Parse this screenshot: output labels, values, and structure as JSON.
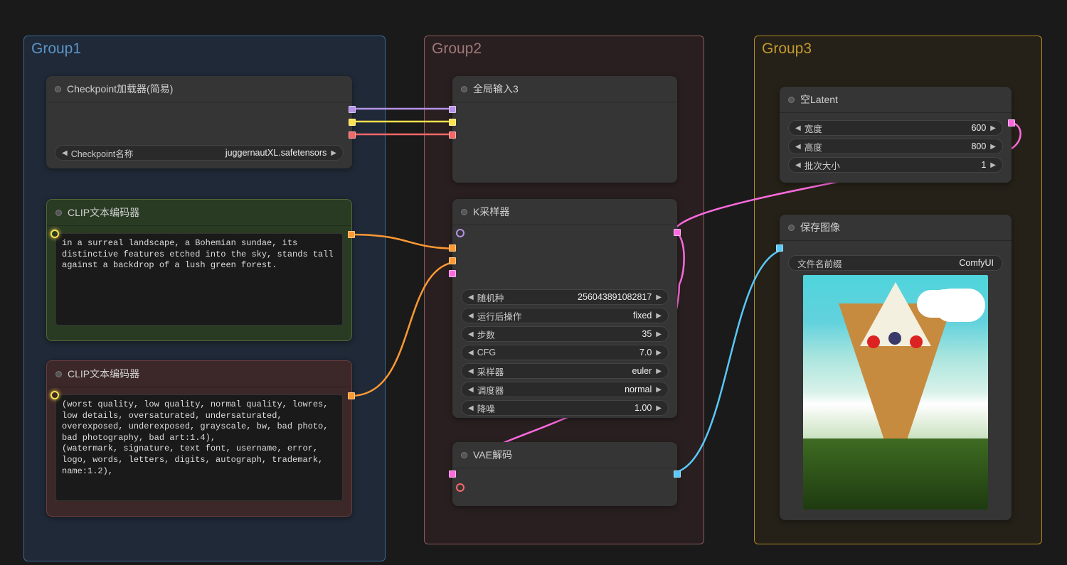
{
  "groups": {
    "g1": {
      "title": "Group1"
    },
    "g2": {
      "title": "Group2"
    },
    "g3": {
      "title": "Group3"
    }
  },
  "nodes": {
    "checkpoint": {
      "title": "Checkpoint加载器(简易)",
      "widget_label": "Checkpoint名称",
      "widget_value": "juggernautXL.safetensors"
    },
    "clip_pos": {
      "title": "CLIP文本编码器",
      "text": "in a surreal landscape, a Bohemian sundae, its distinctive features etched into the sky, stands tall against a backdrop of a lush green forest."
    },
    "clip_neg": {
      "title": "CLIP文本编码器",
      "text": "(worst quality, low quality, normal quality, lowres, low details, oversaturated, undersaturated, overexposed, underexposed, grayscale, bw, bad photo, bad photography, bad art:1.4),\n(watermark, signature, text font, username, error, logo, words, letters, digits, autograph, trademark, name:1.2),"
    },
    "global_in": {
      "title": "全局输入3"
    },
    "ksampler": {
      "title": "K采样器",
      "widgets": [
        {
          "label": "随机种",
          "value": "256043891082817"
        },
        {
          "label": "运行后操作",
          "value": "fixed"
        },
        {
          "label": "步数",
          "value": "35"
        },
        {
          "label": "CFG",
          "value": "7.0"
        },
        {
          "label": "采样器",
          "value": "euler"
        },
        {
          "label": "调度器",
          "value": "normal"
        },
        {
          "label": "降噪",
          "value": "1.00"
        }
      ]
    },
    "vae_decode": {
      "title": "VAE解码"
    },
    "empty_latent": {
      "title": "空Latent",
      "widgets": [
        {
          "label": "宽度",
          "value": "600"
        },
        {
          "label": "高度",
          "value": "800"
        },
        {
          "label": "批次大小",
          "value": "1"
        }
      ]
    },
    "save_image": {
      "title": "保存图像",
      "widget_label": "文件名前缀",
      "widget_value": "ComfyUI"
    }
  }
}
